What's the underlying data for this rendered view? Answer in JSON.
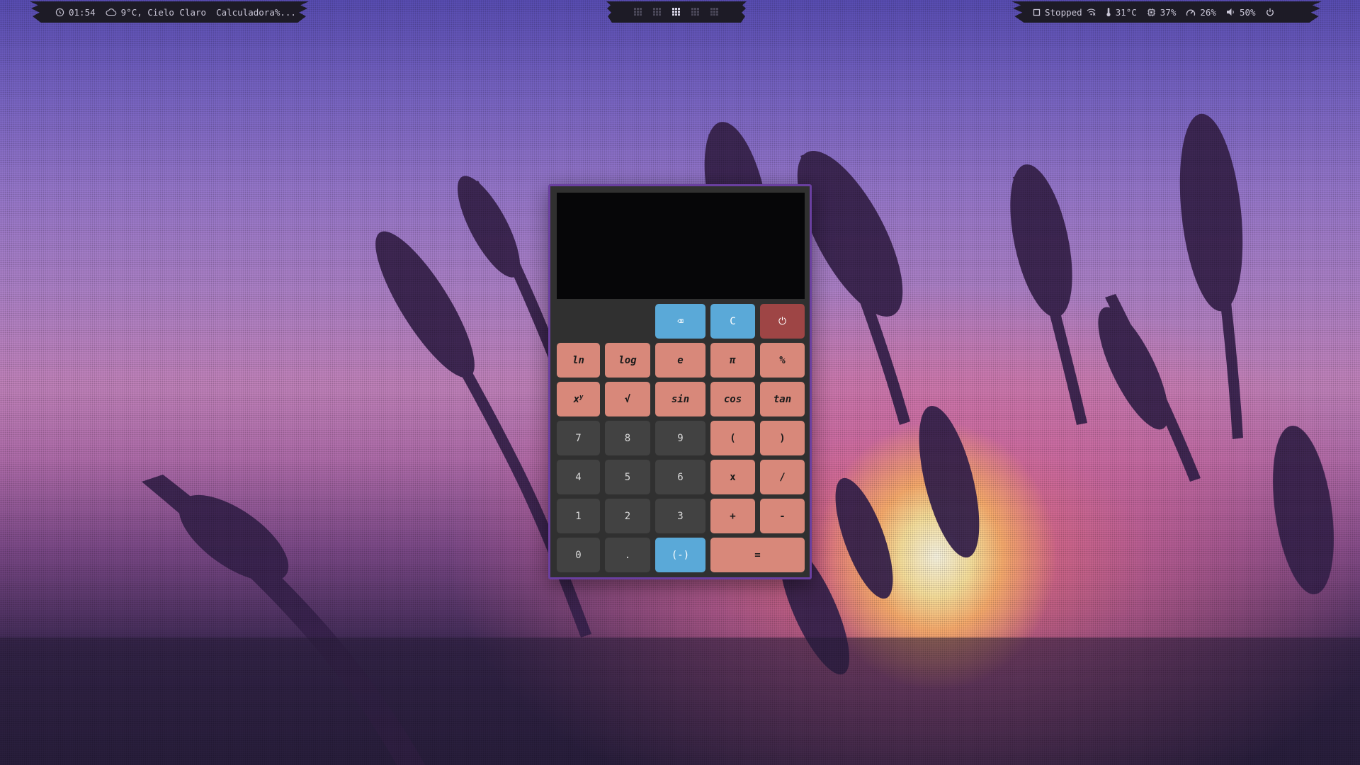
{
  "colors": {
    "bar_background": "#1d1b26",
    "bar_text": "#c9c6d6",
    "calc_border": "#6a3fa0",
    "calc_body": "#303030",
    "display_bg": "#060608",
    "key_dark": "#424242",
    "key_salmon": "#d8887a",
    "key_blue": "#5aa9d8",
    "key_red": "#9e4545"
  },
  "top_bar_left": {
    "clock_icon": "clock-icon",
    "time": "01:54",
    "weather_icon": "cloud-icon",
    "weather": "9°C, Cielo Claro",
    "window_title": "Calculadora%..."
  },
  "workspaces": {
    "count": 5,
    "active_index": 3
  },
  "top_bar_right": {
    "media_icon": "square-stop-icon",
    "media_status": "Stopped",
    "network_icon": "wifi-off-icon",
    "temp_icon": "thermometer-icon",
    "temperature": "31°C",
    "cpu_icon": "cpu-icon",
    "cpu": "37%",
    "memory_icon": "gauge-icon",
    "memory": "26%",
    "volume_icon": "speaker-icon",
    "volume": "50%",
    "power_icon": "power-icon"
  },
  "calculator": {
    "display_value": "",
    "keys": {
      "backspace": "⌫",
      "clear": "C",
      "power": "⏻",
      "ln": "ln",
      "log": "log",
      "e": "e",
      "pi": "π",
      "percent": "%",
      "pow_base": "x",
      "pow_exp": "y",
      "sqrt": "√",
      "sin": "sin",
      "cos": "cos",
      "tan": "tan",
      "seven": "7",
      "eight": "8",
      "nine": "9",
      "lparen": "(",
      "rparen": ")",
      "four": "4",
      "five": "5",
      "six": "6",
      "multiply": "x",
      "divide": "/",
      "one": "1",
      "two": "2",
      "three": "3",
      "plus": "+",
      "minus": "-",
      "zero": "0",
      "dot": ".",
      "negate": "(-)",
      "equals": "="
    }
  }
}
